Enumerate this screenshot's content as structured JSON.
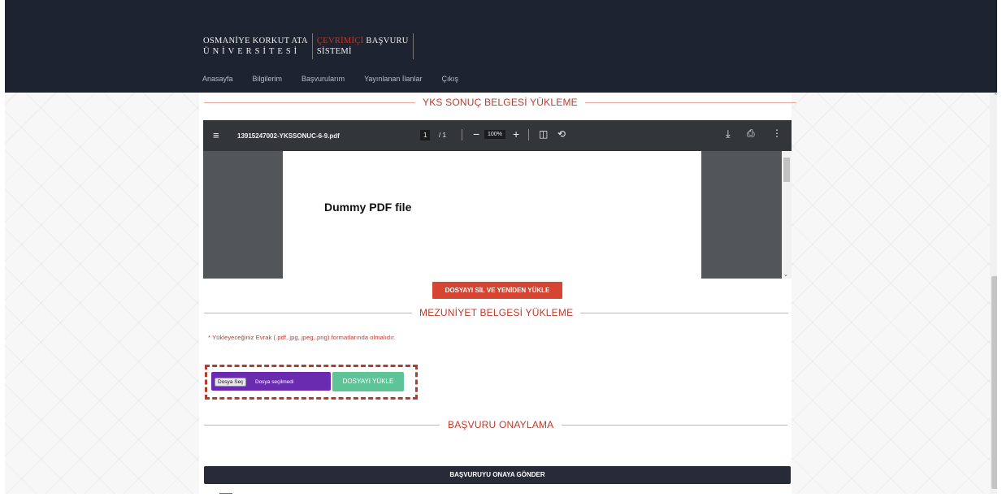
{
  "brand": {
    "university_line1": "OSMANİYE KORKUT ATA",
    "university_line2": "ÜNİVERSİTESİ",
    "system_red": "ÇEVRİMİÇİ",
    "system_white": "BAŞVURU",
    "system_line2": "SİSTEMİ"
  },
  "nav": {
    "items": [
      "Anasayfa",
      "Bilgilerim",
      "Başvurularım",
      "Yayınlanan İlanlar",
      "Çıkış"
    ]
  },
  "sections": {
    "yks_title": "YKS SONUÇ BELGESİ YÜKLEME",
    "mezuniyet_title": "MEZUNİYET BELGESİ YÜKLEME",
    "onay_title": "BAŞVURU ONAYLAMA"
  },
  "pdf_viewer": {
    "file_name": "13915247002-YKSSONUC-6-9.pdf",
    "current_page": "1",
    "total_pages": "/ 1",
    "zoom": "100%",
    "page_text": "Dummy PDF file"
  },
  "buttons": {
    "delete_reupload": "DOSYAYI SİL VE YENİDEN YÜKLE",
    "choose_file": "Dosya Seç",
    "upload": "DOSYAYI YÜKLE",
    "submit": "BAŞVURUYU ONAYA GÖNDER"
  },
  "file_input": {
    "status": "Dosya seçilmedi"
  },
  "note": "* Yükleyeceğiniz Evrak (.pdf,.jpg,.jpeg,.png) formatlarında olmalıdır.",
  "colors": {
    "header_bg": "#1e2330",
    "accent_red": "#d64532",
    "upload_green": "#5cc497",
    "file_input_purple": "#6a2bb0",
    "submit_dark": "#262b37"
  }
}
